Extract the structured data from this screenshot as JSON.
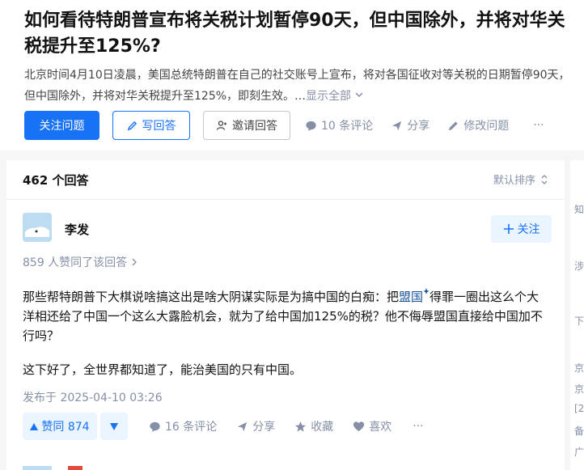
{
  "question": {
    "title": "如何看待特朗普宣布将关税计划暂停90天，但中国除外，并将对华关税提升至125%?",
    "description": "北京时间4月10日凌晨，美国总统特朗普在自己的社交账号上宣布，将对各国征收对等关税的日期暂停90天，但中国除外，并将对华关税提升至125%，即刻生效。…",
    "show_all": "显示全部",
    "actions": {
      "follow": "关注问题",
      "write": "写回答",
      "invite": "邀请回答",
      "comments": "10 条评论",
      "share": "分享",
      "edit": "修改问题",
      "more": "···"
    }
  },
  "answers": {
    "count": "462 个回答",
    "sort": "默认排序",
    "first": {
      "author": "李发",
      "follow": "关注",
      "agree_note": "859 人赞同了该回答",
      "paragraph1_before": "那些帮特朗普下大棋说啥搞这出是啥大阴谋实际是为搞中国的白痴：把",
      "paragraph1_link": "盟国",
      "paragraph1_after": "得罪一圈出这么个大洋相还给了中国一个这么大露脸机会，就为了给中国加125%的税？他不侮辱盟国直接给中国加不行吗？",
      "paragraph2": "这下好了，全世界都知道了，能治美国的只有中国。",
      "published": "发布于 2025-04-10 03:26",
      "vote_up": "赞同 874",
      "comments": "16 条评论",
      "share": "分享",
      "favorite": "收藏",
      "like": "喜欢",
      "more": "···"
    }
  },
  "sidebar_fragments": [
    "知",
    "涉",
    "下",
    "京",
    "京",
    "[2",
    "备",
    "广"
  ],
  "colors": {
    "primary": "#1772f6",
    "muted": "#8590a6",
    "link": "#175199",
    "light_blue": "#ebf5ff"
  }
}
